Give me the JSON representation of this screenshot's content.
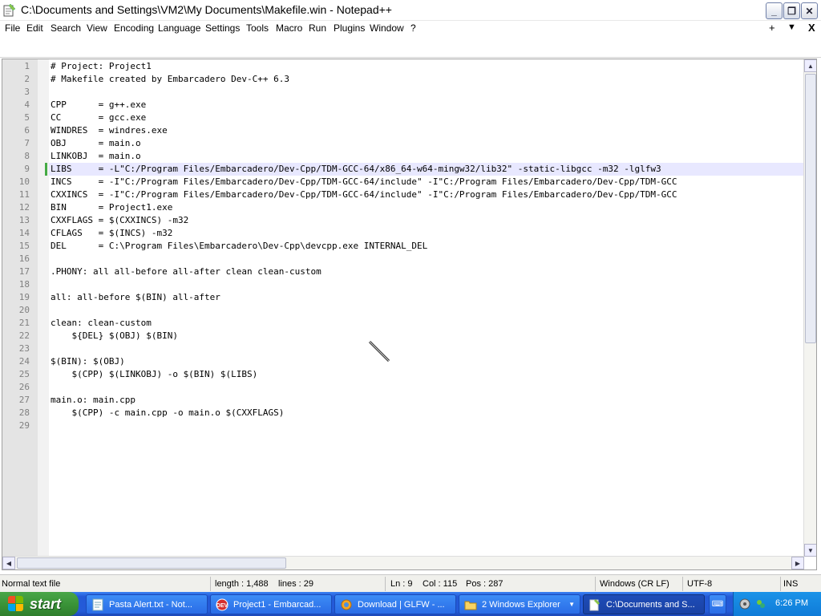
{
  "window": {
    "title": "C:\\Documents and Settings\\VM2\\My Documents\\Makefile.win - Notepad++",
    "minimize_label": "_",
    "restore_label": "❐",
    "close_label": "✕"
  },
  "menu": {
    "items": [
      "File",
      "Edit",
      "Search",
      "View",
      "Encoding",
      "Language",
      "Settings",
      "Tools",
      "Macro",
      "Run",
      "Plugins",
      "Window",
      "?"
    ],
    "right_plus": "+",
    "right_down": "▼",
    "right_close": "X"
  },
  "editor": {
    "current_line": 9,
    "lines": [
      "# Project: Project1",
      "# Makefile created by Embarcadero Dev-C++ 6.3",
      "",
      "CPP      = g++.exe",
      "CC       = gcc.exe",
      "WINDRES  = windres.exe",
      "OBJ      = main.o",
      "LINKOBJ  = main.o",
      "LIBS     = -L\"C:/Program Files/Embarcadero/Dev-Cpp/TDM-GCC-64/x86_64-w64-mingw32/lib32\" -static-libgcc -m32 -lglfw3",
      "INCS     = -I\"C:/Program Files/Embarcadero/Dev-Cpp/TDM-GCC-64/include\" -I\"C:/Program Files/Embarcadero/Dev-Cpp/TDM-GCC",
      "CXXINCS  = -I\"C:/Program Files/Embarcadero/Dev-Cpp/TDM-GCC-64/include\" -I\"C:/Program Files/Embarcadero/Dev-Cpp/TDM-GCC",
      "BIN      = Project1.exe",
      "CXXFLAGS = $(CXXINCS) -m32",
      "CFLAGS   = $(INCS) -m32",
      "DEL      = C:\\Program Files\\Embarcadero\\Dev-Cpp\\devcpp.exe INTERNAL_DEL",
      "",
      ".PHONY: all all-before all-after clean clean-custom",
      "",
      "all: all-before $(BIN) all-after",
      "",
      "clean: clean-custom",
      "    ${DEL} $(OBJ) $(BIN)",
      "",
      "$(BIN): $(OBJ)",
      "    $(CPP) $(LINKOBJ) -o $(BIN) $(LIBS)",
      "",
      "main.o: main.cpp",
      "    $(CPP) -c main.cpp -o main.o $(CXXFLAGS)",
      ""
    ]
  },
  "status": {
    "file_type": "Normal text file",
    "length": "length : 1,488",
    "lines": "lines : 29",
    "ln": "Ln : 9",
    "col": "Col : 115",
    "pos": "Pos : 287",
    "eol": "Windows (CR LF)",
    "encoding": "UTF-8",
    "mode": "INS"
  },
  "taskbar": {
    "start_label": "start",
    "buttons": [
      {
        "label": "Pasta Alert.txt - Not...",
        "icon": "notepad-icon"
      },
      {
        "label": "Project1 - Embarcad...",
        "icon": "devcpp-icon"
      },
      {
        "label": "Download | GLFW - ...",
        "icon": "browser-icon"
      },
      {
        "label": "2 Windows Explorer",
        "icon": "folder-icon"
      },
      {
        "label": "C:\\Documents and S...",
        "icon": "notepadpp-icon"
      }
    ],
    "clock": "6:26 PM"
  }
}
